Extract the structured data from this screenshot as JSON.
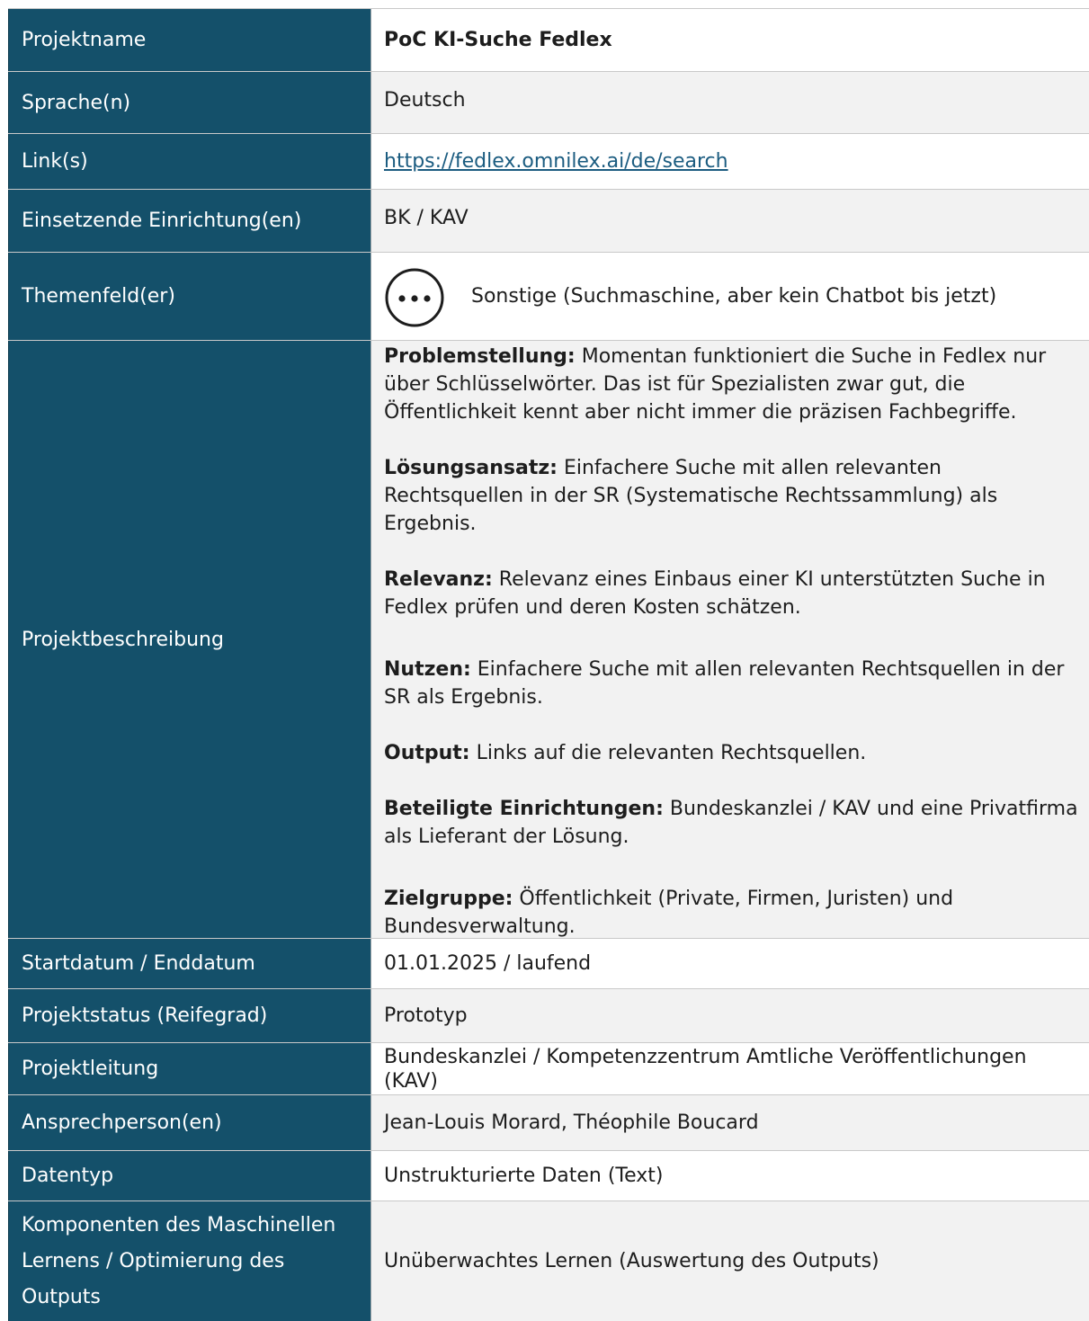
{
  "rows": {
    "projektname": {
      "label": "Projektname",
      "value": "PoC KI-Suche Fedlex"
    },
    "sprache": {
      "label": "Sprache(n)",
      "value": "Deutsch"
    },
    "links": {
      "label": "Link(s)",
      "value": "https://fedlex.omnilex.ai/de/search"
    },
    "einrichtung": {
      "label": "Einsetzende Einrichtung(en)",
      "value": "BK / KAV"
    },
    "themenfeld": {
      "label": "Themenfeld(er)",
      "value": "Sonstige (Suchmaschine, aber kein Chatbot bis jetzt)",
      "icon": "more-options-icon"
    },
    "beschreibung": {
      "label": "Projektbeschreibung",
      "sections": [
        {
          "heading": "Problemstellung:",
          "text": " Momentan funktioniert die Suche in Fedlex nur über Schlüsselwörter. Das ist für Spezialisten zwar gut, die Öffentlichkeit kennt aber nicht immer die präzisen Fachbegriffe."
        },
        {
          "heading": "Lösungsansatz:",
          "text": " Einfachere Suche mit allen relevanten Rechtsquellen in der SR (Systematische Rechtssammlung) als Ergebnis."
        },
        {
          "heading": "Relevanz:",
          "text": " Relevanz eines Einbaus einer KI unterstützten Suche in Fedlex prüfen und deren Kosten schätzen."
        },
        {
          "heading": "Nutzen:",
          "text": " Einfachere Suche mit allen relevanten Rechtsquellen in der SR als Ergebnis."
        },
        {
          "heading": "Output:",
          "text": " Links auf die relevanten Rechtsquellen."
        },
        {
          "heading": "Beteiligte Einrichtungen:",
          "text": " Bundeskanzlei / KAV und eine Privatfirma als Lieferant der Lösung."
        },
        {
          "heading": "Zielgruppe:",
          "text": " Öffentlichkeit (Private, Firmen, Juristen) und Bundesverwaltung."
        }
      ]
    },
    "datum": {
      "label": "Startdatum / Enddatum",
      "value": "01.01.2025 / laufend"
    },
    "status": {
      "label": "Projektstatus (Reifegrad)",
      "value": "Prototyp"
    },
    "leitung": {
      "label": "Projektleitung",
      "value": "Bundeskanzlei / Kompetenzzentrum Amtliche Veröffentlichungen (KAV)"
    },
    "ansprech": {
      "label": "Ansprechperson(en)",
      "value": "Jean-Louis Morard, Théophile Boucard"
    },
    "datentyp": {
      "label": "Datentyp",
      "value": "Unstrukturierte Daten (Text)"
    },
    "ml": {
      "label": "Komponenten des Maschinellen Lernens / Optimierung des Outputs",
      "value": "Unüberwachtes Lernen (Auswertung des Outputs)"
    }
  },
  "colors": {
    "label_bg": "#14506a",
    "alt_row": "#f2f2f2",
    "link": "#1b5c80"
  }
}
